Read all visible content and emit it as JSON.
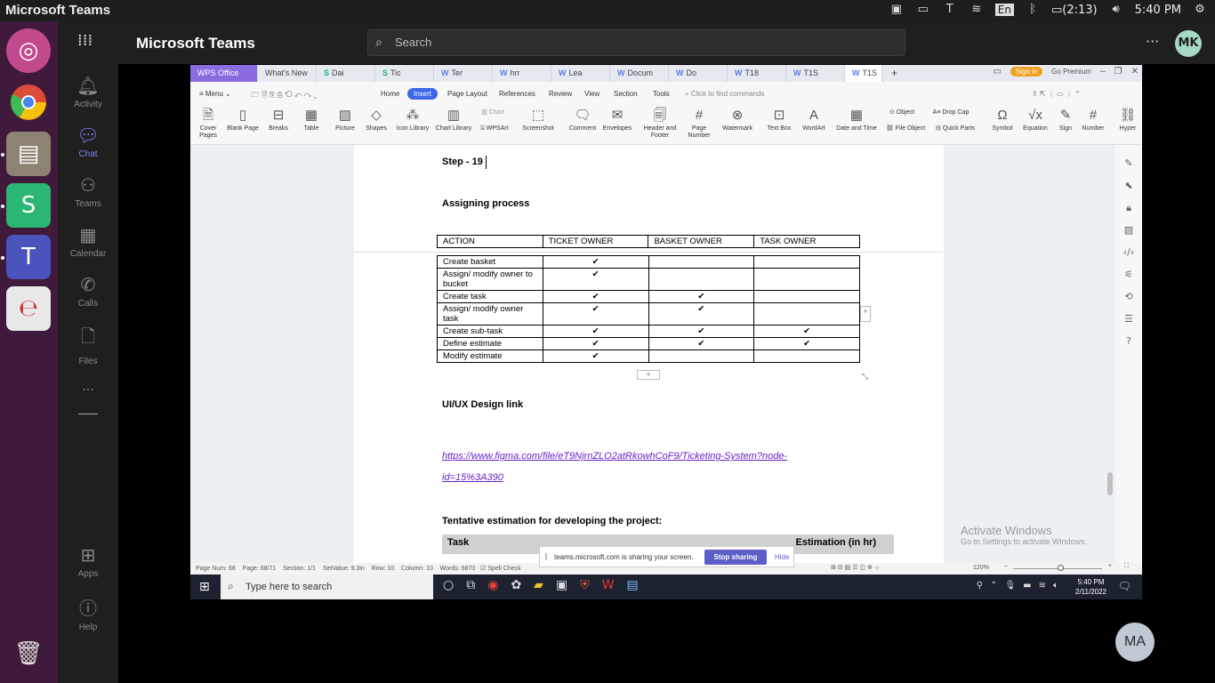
{
  "system": {
    "app_title": "Microsoft Teams",
    "lang": "En",
    "battery": "(2:13)",
    "time": "5:40 PM"
  },
  "rail": {
    "items": [
      {
        "label": "Activity",
        "icon": "bell-icon"
      },
      {
        "label": "Chat",
        "icon": "chat-icon"
      },
      {
        "label": "Teams",
        "icon": "teams-icon"
      },
      {
        "label": "Calendar",
        "icon": "calendar-icon"
      },
      {
        "label": "Calls",
        "icon": "phone-icon"
      },
      {
        "label": "Files",
        "icon": "file-icon"
      }
    ],
    "more": "...",
    "apps": "Apps",
    "help": "Help"
  },
  "header": {
    "title": "Microsoft Teams",
    "search_placeholder": "Search",
    "user_initials": "MK"
  },
  "wps": {
    "brand": "WPS Office",
    "tabs": [
      "What's New",
      "Dai",
      "Tic",
      "Ter",
      "hrr",
      "Lea",
      "Docum",
      "Do",
      "T18",
      "T1S",
      "T1S"
    ],
    "signin": "Sign in",
    "premium": "Go Premium",
    "menu": {
      "menu": "Menu",
      "home": "Home",
      "insert": "Insert",
      "page_layout": "Page Layout",
      "references": "References",
      "review": "Review",
      "view": "View",
      "section": "Section",
      "tools": "Tools",
      "find": "Click to find commands"
    },
    "ribbon": [
      "Cover Pages",
      "Blank Page",
      "Breaks",
      "Table",
      "Picture",
      "Shapes",
      "Icon Library",
      "Chart Library",
      "Screenshot",
      "Comment",
      "Envelopes",
      "Header and Footer",
      "Page Number",
      "Watermark",
      "Text Box",
      "WordArt",
      "Date and Time",
      "Symbol",
      "Equation",
      "Sign",
      "Number",
      "Hyper"
    ],
    "ribbon_small": {
      "chart": "Chart",
      "wpsart": "WPSArt",
      "object": "Object",
      "drop_cap": "Drop Cap",
      "file_object": "File Object",
      "quick_parts": "Quick Parts"
    },
    "status": {
      "page_num": "Page Num: 68",
      "page": "Page: 68/71",
      "section": "Section: 1/1",
      "setvalue": "SetValue: 9.3in",
      "row": "Row: 10",
      "column": "Column: 10",
      "words": "Words: 6870",
      "spell": "Spell Check",
      "zoom": "120%"
    }
  },
  "document": {
    "step": "Step - 19",
    "assigning": "Assigning process",
    "table": {
      "headers": [
        "ACTION",
        "TICKET OWNER",
        "BASKET OWNER",
        "TASK OWNER"
      ],
      "rows": [
        [
          "Create basket",
          "✔",
          "",
          ""
        ],
        [
          "Assign/ modify owner to bucket",
          "✔",
          "",
          ""
        ],
        [
          "Create task",
          "✔",
          "✔",
          ""
        ],
        [
          "Assign/ modify owner task",
          "✔",
          "✔",
          ""
        ],
        [
          "Create sub-task",
          "✔",
          "✔",
          "✔"
        ],
        [
          "Define estimate",
          "✔",
          "✔",
          "✔"
        ],
        [
          "Modify estimate",
          "✔",
          "",
          ""
        ]
      ]
    },
    "uiux": "UI/UX Design link",
    "link_line1": "https://www.figma.com/file/eT9NjrnZLO2atRkowhCoF9/Ticketing-System?node-",
    "link_line2": "id=15%3A390",
    "tentative": "Tentative estimation for developing the project:",
    "est_task": "Task",
    "est_hours": "Estimation (in hr)"
  },
  "sharebar": {
    "message": "teams.microsoft.com is sharing your screen.",
    "stop": "Stop sharing",
    "hide": "Hide"
  },
  "activate": {
    "line1": "Activate Windows",
    "line2": "Go to Settings to activate Windows."
  },
  "taskbar": {
    "search": "Type here to search",
    "time": "5:40 PM",
    "date": "2/11/2022"
  },
  "presenter": {
    "initials": "MA"
  },
  "colors": {
    "dock": "#3f1a3a",
    "teams_accent": "#7f85f5",
    "wps_brand": "#8b6be0",
    "insert_tab": "#3d67e8",
    "link": "#6a1fc7",
    "stop_sharing": "#5b5fc7"
  }
}
